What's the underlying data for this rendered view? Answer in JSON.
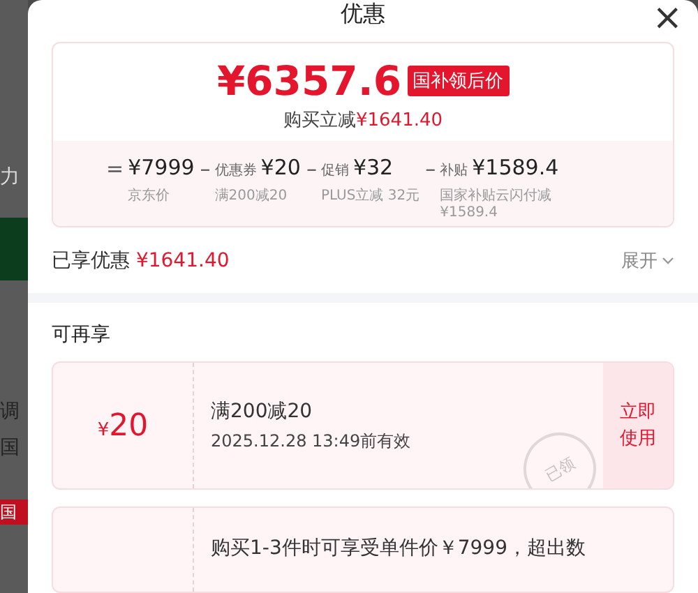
{
  "background_page": {
    "snippets": [
      {
        "text": "力",
        "kind": "plain"
      },
      {
        "text": "调",
        "kind": "plain"
      },
      {
        "text": "国",
        "kind": "plain"
      },
      {
        "text": "国",
        "kind": "tag"
      }
    ]
  },
  "sheet": {
    "title": "优惠",
    "close": "×"
  },
  "summary": {
    "price": "¥6357.6",
    "price_tag": "国补领后价",
    "saving_label": "购买立减",
    "saving_amount": "¥1641.40",
    "breakdown": [
      {
        "op": "=",
        "amount": "¥7999",
        "note": "京东价"
      },
      {
        "op": "–",
        "label": "优惠券",
        "amount": "¥20",
        "note": "满200减20"
      },
      {
        "op": "–",
        "label": "促销",
        "amount": "¥32",
        "note": "PLUS立减 32元"
      },
      {
        "op": "–",
        "label": "补贴",
        "amount": "¥1589.4",
        "note": "国家补贴云闪付减 ¥1589.4"
      }
    ]
  },
  "enjoyed": {
    "label": "已享优惠",
    "amount": "¥1641.40",
    "toggle": "展开"
  },
  "more": {
    "title": "可再享",
    "coupons": [
      {
        "kind": "coupon",
        "currency": "¥",
        "value": "20",
        "title": "满200减20",
        "detail": "2025.12.28 13:49前有效",
        "stamp": "已领",
        "action": "立即使用"
      },
      {
        "kind": "limit",
        "detail": "购买1-3件时可享受单件价￥7999，超出数"
      }
    ]
  }
}
